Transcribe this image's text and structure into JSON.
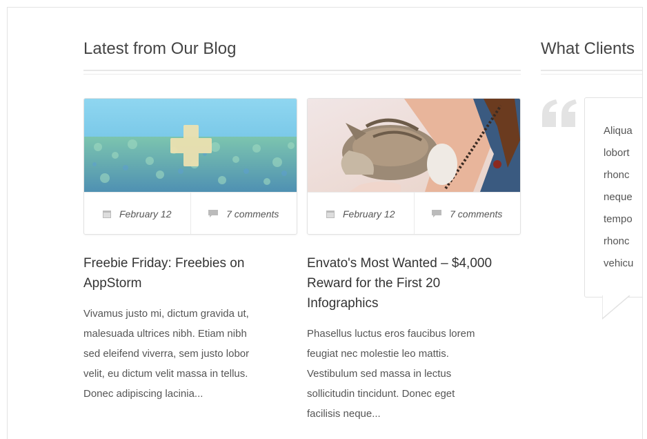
{
  "blog": {
    "heading": "Latest from Our Blog",
    "posts": [
      {
        "date": "February 12",
        "comments": "7 comments",
        "title_lines": [
          "Freebie Friday: Freebies on",
          "AppStorm"
        ],
        "excerpt_lines": [
          "Vivamus justo mi, dictum gravida ut,",
          "malesuada ultrices nibh. Etiam nibh",
          "sed eleifend viverra, sem justo lobor",
          "velit, eu dictum velit massa in tellus.",
          "Donec adipiscing lacinia..."
        ]
      },
      {
        "date": "February 12",
        "comments": "7 comments",
        "title_lines": [
          "Envato's Most Wanted – $4,000",
          "Reward for the First 20",
          "Infographics"
        ],
        "excerpt_lines": [
          "Phasellus luctus eros faucibus lorem",
          "feugiat nec molestie leo mattis.",
          "Vestibulum sed massa in lectus",
          "sollicitudin tincidunt. Donec eget",
          "facilisis neque..."
        ]
      }
    ]
  },
  "testimonials": {
    "heading": "What Clients",
    "quote_lines": [
      "Aliqua",
      "lobort",
      "rhonc",
      "neque",
      "tempo",
      "rhonc",
      "vehicu"
    ]
  },
  "icons": {
    "calendar": "calendar-icon",
    "comments": "comment-icon",
    "quote": "quote-icon",
    "plus": "plus-icon"
  },
  "colors": {
    "rule": "#e7e7e7",
    "text": "#333333",
    "muted": "#555555",
    "icon": "#bbbbbb"
  }
}
